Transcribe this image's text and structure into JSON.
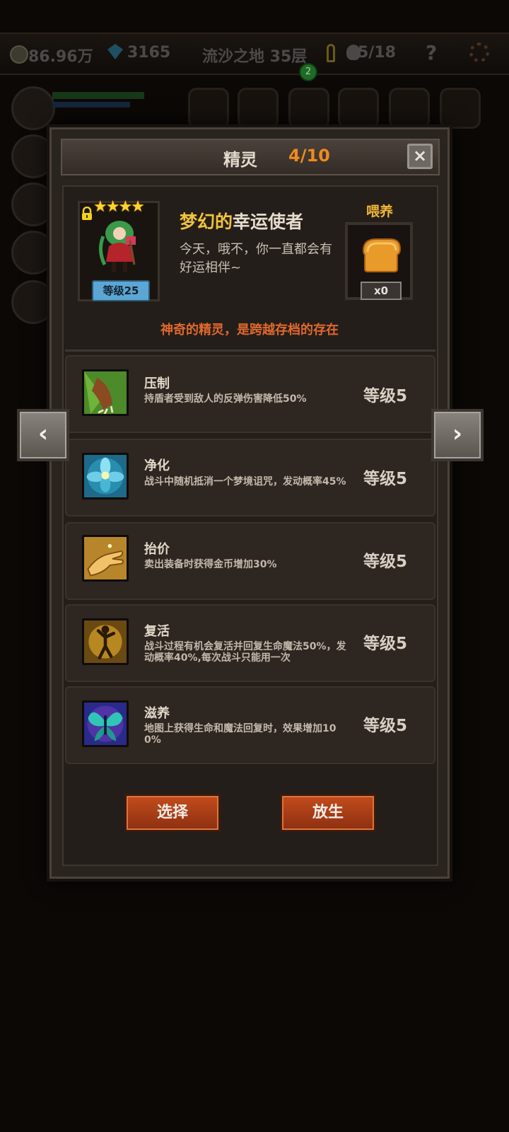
{
  "hud": {
    "gold": "86.96万",
    "gems": "3165",
    "location": "流沙之地 35层",
    "kills": "5/18",
    "help": "?",
    "badge": "2"
  },
  "dialog": {
    "title": "精灵",
    "count": "4/10",
    "close": "×"
  },
  "sprite": {
    "stars": "★★★★",
    "level": "等级25",
    "name_highlight": "梦幻的",
    "name_rest": "幸运使者",
    "description": "今天，哦不，你一直都会有好运相伴~",
    "feed_label": "喂养",
    "feed_count": "x0",
    "subtitle": "神奇的精灵，是跨越存档的存在"
  },
  "skills": [
    {
      "name": "压制",
      "desc": "持盾者受到敌人的反弹伤害降低50%",
      "level": "等级5",
      "icon": "claw-icon"
    },
    {
      "name": "净化",
      "desc": "战斗中随机抵消一个梦境诅咒，发动概率45%",
      "level": "等级5",
      "icon": "blue-flower-icon"
    },
    {
      "name": "抬价",
      "desc": "卖出装备时获得金币增加30%",
      "level": "等级5",
      "icon": "hand-icon"
    },
    {
      "name": "复活",
      "desc": "战斗过程有机会复活并回复生命魔法50%，发动概率40%,每次战斗只能用一次",
      "level": "等级5",
      "icon": "revive-figure-icon"
    },
    {
      "name": "滋养",
      "desc": "地图上获得生命和魔法回复时，效果增加100%",
      "level": "等级5",
      "icon": "fairy-wings-icon"
    }
  ],
  "buttons": {
    "select": "选择",
    "release": "放生"
  },
  "nav": {
    "prev": "‹",
    "next": "›"
  },
  "colors": {
    "accent_orange": "#f08a1e",
    "name_gold": "#f1c33b",
    "subtitle_orange": "#e0682d",
    "button_red": "#c24c1c"
  }
}
